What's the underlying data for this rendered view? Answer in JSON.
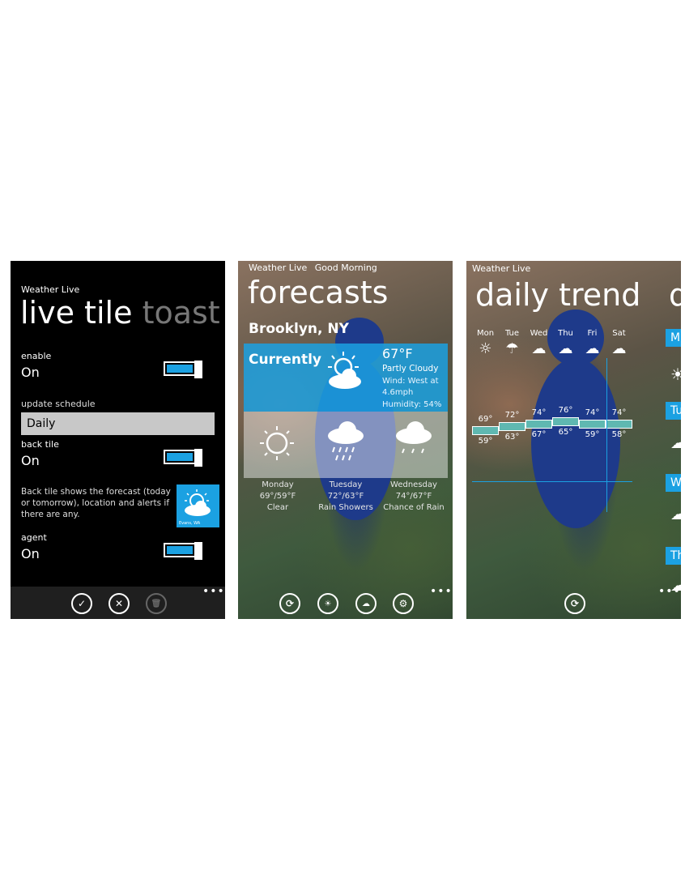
{
  "screen1": {
    "app_title": "Weather Live",
    "pivot_active": "live tile",
    "pivot_next": "toast lo",
    "enable_label": "enable",
    "enable_value": "On",
    "schedule_label": "update schedule",
    "schedule_value": "Daily",
    "back_tile_label": "back tile",
    "back_tile_value": "On",
    "back_tile_desc": "Back tile shows the forecast (today or tomorrow), location and alerts if there are any.",
    "tile_preview_location": "Evans, WA",
    "agent_label": "agent",
    "agent_value": "On",
    "accent_color": "#1ba1e2"
  },
  "screen2": {
    "app_title": "Weather Live",
    "greeting": "Good Morning",
    "page_title": "forecasts",
    "location": "Brooklyn, NY",
    "current_label": "Currently",
    "current_temp": "67°F",
    "current_condition": "Partly Cloudy",
    "current_wind": "Wind: West at 4.6mph",
    "current_humidity": "Humidity: 54%",
    "forecast": [
      {
        "day": "Monday",
        "temps": "69°/59°F",
        "condition": "Clear",
        "icon": "sun-icon"
      },
      {
        "day": "Tuesday",
        "temps": "72°/63°F",
        "condition": "Rain Showers",
        "icon": "rain-cloud-icon"
      },
      {
        "day": "Wednesday",
        "temps": "74°/67°F",
        "condition": "Chance of Rain",
        "icon": "cloud-drizzle-icon"
      }
    ]
  },
  "screen3": {
    "app_title": "Weather Live",
    "page_title": "daily trend",
    "days": [
      "Mon",
      "Tue",
      "Wed",
      "Thu",
      "Fri",
      "Sat"
    ],
    "highs": [
      "69°",
      "72°",
      "74°",
      "76°",
      "74°",
      "74°"
    ],
    "lows": [
      "59°",
      "63°",
      "67°",
      "65°",
      "59°",
      "58°"
    ],
    "side_tabs": [
      "M",
      "Tu",
      "W",
      "Th"
    ]
  }
}
